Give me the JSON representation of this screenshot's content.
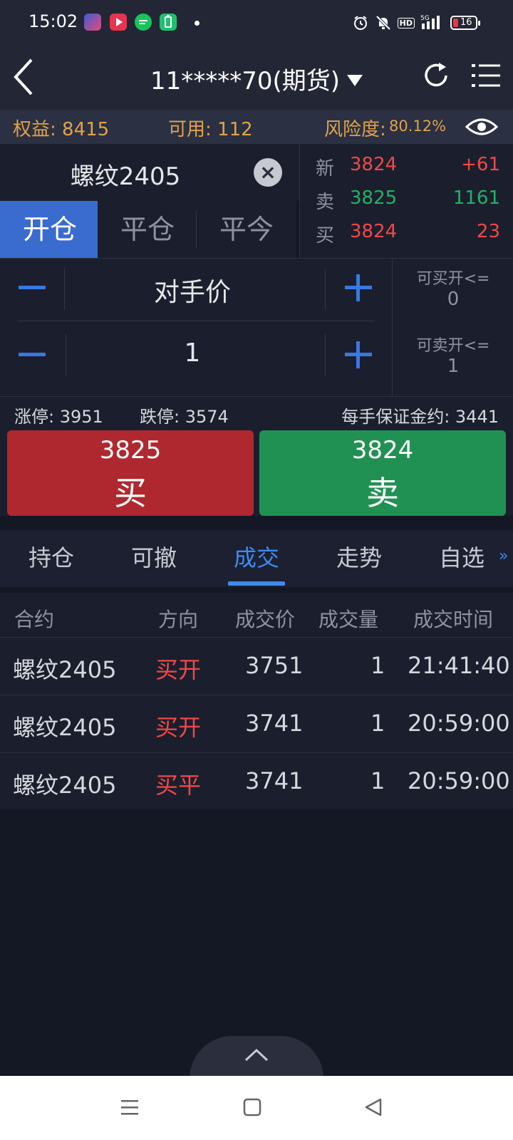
{
  "status_bar": {
    "time": "15:02",
    "network": "5G",
    "battery_level": "16",
    "app_icons": [
      "game-app-icon",
      "video-app-icon",
      "chat-app-icon",
      "battery-app-icon"
    ]
  },
  "header": {
    "account": "11*****70(期货)"
  },
  "account_bar": {
    "equity": "权益: 8415",
    "available": "可用: 112",
    "risk_label": "风险度:",
    "risk_value": "80.12%"
  },
  "order_panel": {
    "contract": "螺纹2405",
    "tabs": [
      "开仓",
      "平仓",
      "平今"
    ],
    "active_tab": 0,
    "price_input": "对手价",
    "quantity_input": "1",
    "avail_buy_label": "可买开<=",
    "avail_buy_value": "0",
    "avail_sell_label": "可卖开<=",
    "avail_sell_value": "1"
  },
  "quote": {
    "rows": [
      {
        "label": "新",
        "price": "3824",
        "value": "+61"
      },
      {
        "label": "卖",
        "price": "3825",
        "value": "1161"
      },
      {
        "label": "买",
        "price": "3824",
        "value": "23"
      }
    ],
    "colors": {
      "up": "#f04848",
      "down": "#23b163"
    }
  },
  "limits": {
    "limit_up": "涨停: 3951",
    "limit_down": "跌停: 3574",
    "margin": "每手保证金约: 3441"
  },
  "buy_button": {
    "price": "3825",
    "label": "买"
  },
  "sell_button": {
    "price": "3824",
    "label": "卖"
  },
  "tabs": {
    "items": [
      "持仓",
      "可撤",
      "成交",
      "走势",
      "自选"
    ],
    "active": "成交",
    "more": "»"
  },
  "trades_table": {
    "headers": [
      "合约",
      "方向",
      "成交价",
      "成交量",
      "成交时间"
    ],
    "rows": [
      [
        "螺纹2405",
        "买开",
        "3751",
        "1",
        "21:41:40"
      ],
      [
        "螺纹2405",
        "买开",
        "3741",
        "1",
        "20:59:00"
      ],
      [
        "螺纹2405",
        "买平",
        "3741",
        "1",
        "20:59:00"
      ]
    ]
  },
  "accent": "#3a6bcf"
}
